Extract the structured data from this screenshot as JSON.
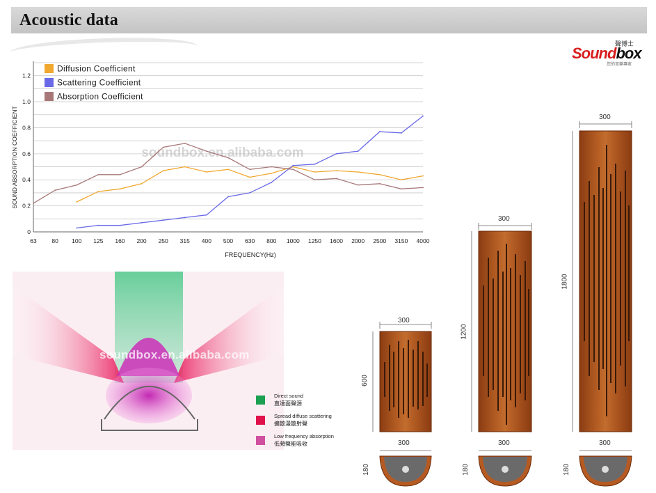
{
  "header": {
    "title": "Acoustic data"
  },
  "logo": {
    "main_prefix": "Sound",
    "main_suffix": "box",
    "chinese": "聲博士",
    "tagline": "您的音樂專家"
  },
  "chart_data": {
    "type": "line",
    "xlabel": "FREQUENCY(Hz)",
    "ylabel": "SOUND ABSORPTION COEFFICIENT",
    "categories": [
      "63",
      "80",
      "100",
      "125",
      "160",
      "200",
      "250",
      "315",
      "400",
      "500",
      "630",
      "800",
      "1000",
      "1250",
      "1600",
      "2000",
      "2500",
      "3150",
      "4000"
    ],
    "yticks": [
      "0",
      "0.2",
      "0.4",
      "0.6",
      "0.8",
      "1.0",
      "1.2"
    ],
    "ylim": [
      0,
      1.3
    ],
    "grid": true,
    "legend_position": "top-left",
    "watermark": "soundbox.en.alibaba.com",
    "series": [
      {
        "name": "Diffusion Coefficient",
        "color": "#f0a830",
        "values": [
          null,
          null,
          0.23,
          0.31,
          0.33,
          0.37,
          0.47,
          0.5,
          0.46,
          0.48,
          0.42,
          0.45,
          0.5,
          0.46,
          0.47,
          0.46,
          0.44,
          0.4,
          0.43
        ]
      },
      {
        "name": "Scattering Coefficient",
        "color": "#6a6ae8",
        "values": [
          null,
          null,
          0.03,
          0.05,
          0.05,
          0.07,
          0.09,
          0.11,
          0.13,
          0.27,
          0.3,
          0.38,
          0.51,
          0.52,
          0.6,
          0.62,
          0.77,
          0.76,
          0.89
        ]
      },
      {
        "name": "Absorption Coefficient",
        "color": "#a87878",
        "values": [
          0.22,
          0.32,
          0.36,
          0.44,
          0.44,
          0.5,
          0.65,
          0.68,
          0.62,
          0.57,
          0.48,
          0.5,
          0.48,
          0.4,
          0.41,
          0.36,
          0.37,
          0.33,
          0.34
        ]
      }
    ]
  },
  "diagram": {
    "watermark": "soundbox.en.alibaba.com",
    "legend": [
      {
        "en": "Direct sound",
        "cn": "直達面聲源",
        "color": "#1aa050"
      },
      {
        "en": "Spread diffuse scattering",
        "cn": "擴散漫散射聲",
        "color": "#e0104a"
      },
      {
        "en": "Low frequency absorption",
        "cn": "低頻聲能吸收",
        "color": "#d050a0"
      }
    ]
  },
  "panels": {
    "small": {
      "width": "300",
      "height": "600",
      "depth": "180",
      "bottom_width": "300"
    },
    "medium": {
      "width": "300",
      "height": "1200",
      "depth": "180",
      "bottom_width": "300"
    },
    "large": {
      "width": "300",
      "height": "1800",
      "depth": "180",
      "bottom_width": "300"
    }
  }
}
